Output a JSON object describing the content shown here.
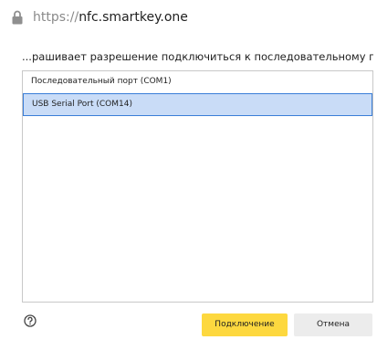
{
  "url": {
    "scheme": "https://",
    "host": "nfc.smartkey.one"
  },
  "prompt": "...рашивает разрешение подключиться к последовательному порту",
  "ports": [
    {
      "label": "Последовательный порт (COM1)",
      "selected": false
    },
    {
      "label": "USB Serial Port (COM14)",
      "selected": true
    }
  ],
  "buttons": {
    "connect": "Подключение",
    "cancel": "Отмена"
  },
  "colors": {
    "accent": "#fdd83f",
    "selection_bg": "#c9dcf7",
    "selection_border": "#3a7ed8"
  },
  "icons": {
    "lock": "lock-icon",
    "help": "help-icon"
  }
}
